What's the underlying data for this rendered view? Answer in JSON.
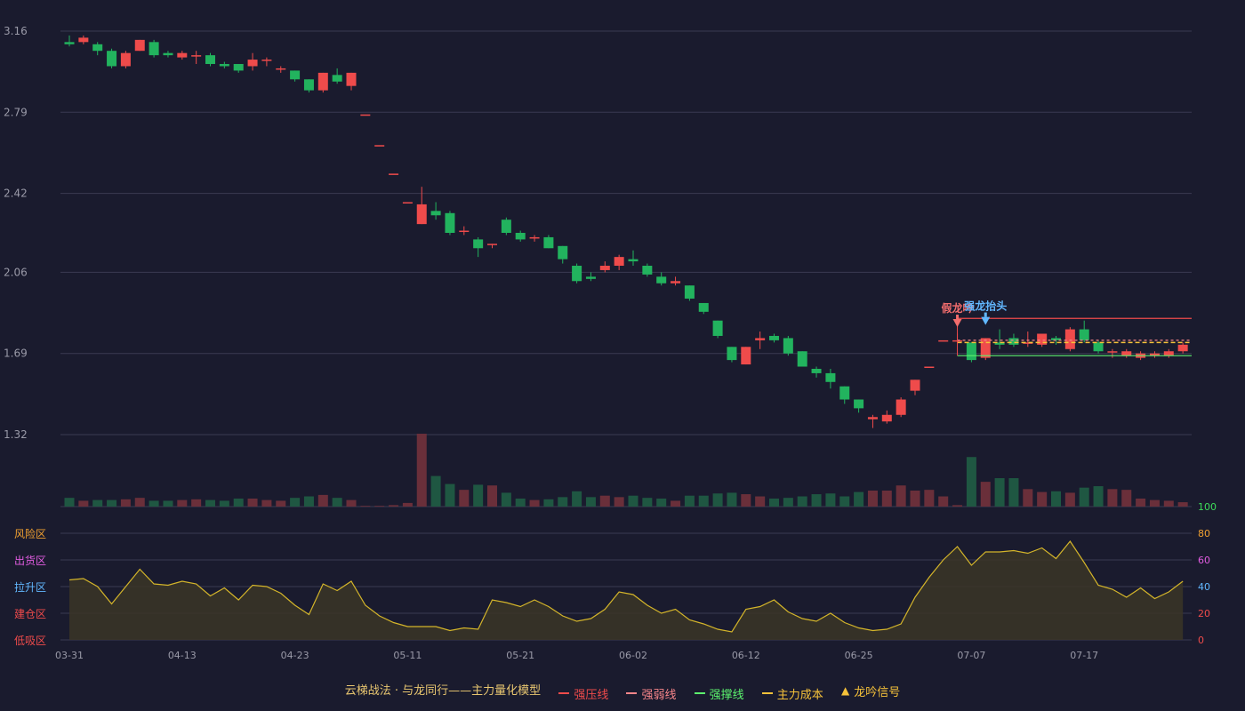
{
  "legend": {
    "title": "云梯战法 · 与龙同行——主力量化模型",
    "items": [
      {
        "label": "强压线",
        "color": "#ef4b4b",
        "style": "solid"
      },
      {
        "label": "强弱线",
        "color": "#f7868a",
        "style": "dashed"
      },
      {
        "label": "强撑线",
        "color": "#5cf26e",
        "style": "solid"
      },
      {
        "label": "主力成本",
        "color": "#f6c23a",
        "style": "dashed"
      },
      {
        "label": "龙吟信号",
        "color": "#f6c23a",
        "style": "triangle"
      }
    ]
  },
  "colors": {
    "background": "#1a1b2e",
    "up": "#ef4b4b",
    "down": "#22b35e",
    "grid": "#3a3b52",
    "axis_text": "#9a9aa8",
    "osc_line": "#d4b52a",
    "osc_fill": "#3b3526",
    "pressure": "#ef4b4b",
    "weak": "#f7868a",
    "support": "#5cf26e",
    "cost": "#f6c23a",
    "fake_dragon": "#f26d6d",
    "dragon_head": "#62b8ff"
  },
  "chart_data": [
    {
      "type": "candlestick",
      "y_ticks": [
        1.32,
        1.69,
        2.06,
        2.42,
        2.79,
        3.16
      ],
      "ylim": [
        1.32,
        3.16
      ],
      "x_tick_labels": [
        {
          "index": 0,
          "label": "03-31"
        },
        {
          "index": 8,
          "label": "04-13"
        },
        {
          "index": 16,
          "label": "04-23"
        },
        {
          "index": 24,
          "label": "05-11"
        },
        {
          "index": 32,
          "label": "05-21"
        },
        {
          "index": 40,
          "label": "06-02"
        },
        {
          "index": 48,
          "label": "06-12"
        },
        {
          "index": 56,
          "label": "06-25"
        },
        {
          "index": 64,
          "label": "07-07"
        },
        {
          "index": 72,
          "label": "07-17"
        }
      ],
      "candles": [
        [
          3.11,
          3.1,
          3.14,
          3.09
        ],
        [
          3.11,
          3.13,
          3.14,
          3.1
        ],
        [
          3.1,
          3.07,
          3.11,
          3.05
        ],
        [
          3.07,
          3.0,
          3.08,
          2.99
        ],
        [
          3.0,
          3.06,
          3.07,
          2.99
        ],
        [
          3.07,
          3.12,
          3.12,
          3.07
        ],
        [
          3.11,
          3.05,
          3.12,
          3.04
        ],
        [
          3.06,
          3.05,
          3.07,
          3.04
        ],
        [
          3.04,
          3.06,
          3.07,
          3.03
        ],
        [
          3.05,
          3.05,
          3.07,
          3.01
        ],
        [
          3.05,
          3.01,
          3.06,
          3.0
        ],
        [
          3.01,
          3.0,
          3.02,
          2.99
        ],
        [
          3.01,
          2.98,
          3.01,
          2.97
        ],
        [
          3.0,
          3.03,
          3.06,
          2.98
        ],
        [
          3.03,
          3.03,
          3.04,
          3.0
        ],
        [
          2.99,
          2.99,
          3.0,
          2.97
        ],
        [
          2.98,
          2.94,
          2.98,
          2.93
        ],
        [
          2.94,
          2.89,
          2.94,
          2.88
        ],
        [
          2.89,
          2.97,
          2.97,
          2.88
        ],
        [
          2.96,
          2.93,
          2.99,
          2.92
        ],
        [
          2.91,
          2.97,
          2.97,
          2.89
        ],
        [
          2.78,
          2.78,
          2.78,
          2.78
        ],
        [
          2.64,
          2.64,
          2.64,
          2.64
        ],
        [
          2.51,
          2.51,
          2.51,
          2.51
        ],
        [
          2.38,
          2.38,
          2.38,
          2.38
        ],
        [
          2.28,
          2.37,
          2.45,
          2.28
        ],
        [
          2.34,
          2.32,
          2.38,
          2.3
        ],
        [
          2.33,
          2.24,
          2.34,
          2.23
        ],
        [
          2.25,
          2.25,
          2.27,
          2.23
        ],
        [
          2.21,
          2.17,
          2.22,
          2.13
        ],
        [
          2.19,
          2.19,
          2.19,
          2.17
        ],
        [
          2.3,
          2.24,
          2.31,
          2.23
        ],
        [
          2.24,
          2.21,
          2.25,
          2.2
        ],
        [
          2.22,
          2.22,
          2.23,
          2.2
        ],
        [
          2.22,
          2.17,
          2.23,
          2.17
        ],
        [
          2.18,
          2.12,
          2.18,
          2.1
        ],
        [
          2.09,
          2.02,
          2.1,
          2.01
        ],
        [
          2.04,
          2.03,
          2.06,
          2.02
        ],
        [
          2.07,
          2.09,
          2.11,
          2.06
        ],
        [
          2.09,
          2.13,
          2.14,
          2.07
        ],
        [
          2.12,
          2.11,
          2.16,
          2.09
        ],
        [
          2.09,
          2.05,
          2.1,
          2.04
        ],
        [
          2.04,
          2.01,
          2.06,
          2.0
        ],
        [
          2.01,
          2.02,
          2.04,
          2.0
        ],
        [
          2.0,
          1.94,
          2.0,
          1.93
        ],
        [
          1.92,
          1.88,
          1.92,
          1.87
        ],
        [
          1.84,
          1.77,
          1.84,
          1.76
        ],
        [
          1.72,
          1.66,
          1.72,
          1.65
        ],
        [
          1.64,
          1.72,
          1.72,
          1.64
        ],
        [
          1.75,
          1.76,
          1.79,
          1.71
        ],
        [
          1.77,
          1.75,
          1.78,
          1.74
        ],
        [
          1.76,
          1.69,
          1.77,
          1.68
        ],
        [
          1.7,
          1.63,
          1.7,
          1.63
        ],
        [
          1.62,
          1.6,
          1.63,
          1.58
        ],
        [
          1.6,
          1.56,
          1.62,
          1.53
        ],
        [
          1.54,
          1.48,
          1.54,
          1.46
        ],
        [
          1.48,
          1.44,
          1.48,
          1.42
        ],
        [
          1.39,
          1.4,
          1.41,
          1.35
        ],
        [
          1.38,
          1.41,
          1.43,
          1.37
        ],
        [
          1.41,
          1.48,
          1.49,
          1.4
        ],
        [
          1.52,
          1.57,
          1.57,
          1.5
        ],
        [
          1.63,
          1.63,
          1.63,
          1.63
        ],
        [
          1.75,
          1.75,
          1.75,
          1.75
        ],
        [
          1.75,
          1.75,
          1.78,
          1.74
        ],
        [
          1.74,
          1.66,
          1.74,
          1.65
        ],
        [
          1.67,
          1.76,
          1.76,
          1.66
        ],
        [
          1.74,
          1.73,
          1.8,
          1.71
        ],
        [
          1.76,
          1.73,
          1.78,
          1.72
        ],
        [
          1.74,
          1.74,
          1.79,
          1.72
        ],
        [
          1.73,
          1.78,
          1.78,
          1.72
        ],
        [
          1.76,
          1.75,
          1.77,
          1.73
        ],
        [
          1.71,
          1.8,
          1.81,
          1.7
        ],
        [
          1.8,
          1.75,
          1.84,
          1.74
        ],
        [
          1.74,
          1.7,
          1.75,
          1.69
        ],
        [
          1.7,
          1.7,
          1.71,
          1.67
        ],
        [
          1.68,
          1.7,
          1.71,
          1.67
        ],
        [
          1.67,
          1.69,
          1.7,
          1.66
        ],
        [
          1.68,
          1.69,
          1.7,
          1.67
        ],
        [
          1.68,
          1.7,
          1.71,
          1.67
        ],
        [
          1.7,
          1.73,
          1.74,
          1.69
        ]
      ],
      "volume": [
        12,
        8,
        9,
        9,
        10,
        12,
        8,
        8,
        9,
        10,
        9,
        8,
        11,
        11,
        9,
        8,
        12,
        14,
        16,
        12,
        9,
        1,
        1,
        2,
        5,
        100,
        42,
        31,
        23,
        30,
        29,
        19,
        11,
        9,
        10,
        13,
        21,
        13,
        15,
        13,
        15,
        12,
        11,
        8,
        15,
        15,
        18,
        19,
        17,
        14,
        11,
        12,
        14,
        17,
        18,
        14,
        20,
        22,
        22,
        29,
        22,
        23,
        14,
        2,
        68,
        34,
        39,
        39,
        24,
        20,
        21,
        19,
        26,
        28,
        24,
        23,
        11,
        9,
        8,
        6,
        9
      ],
      "volume_scale_label": "100",
      "pressure_line": {
        "from_index": 63,
        "value": 1.85
      },
      "weak_line": {
        "from_index": 63,
        "value": 1.75
      },
      "cost_line": {
        "from_index": 63,
        "value": 1.74
      },
      "support_line": {
        "from_index": 63,
        "value": 1.68
      },
      "annotations": [
        {
          "index": 63,
          "text": "假龙吟",
          "kind": "fake_dragon",
          "price": 1.79
        },
        {
          "index": 65,
          "text": "强龙抬头",
          "kind": "dragon_head",
          "price": 1.8
        }
      ]
    },
    {
      "type": "area",
      "ylim": [
        0,
        80
      ],
      "y_ticks": [
        0,
        20,
        40,
        60,
        80
      ],
      "y_tick_colors": [
        "#ef4b4b",
        "#ef4b4b",
        "#62b8ff",
        "#e05ce0",
        "#f0a030"
      ],
      "zone_labels": [
        {
          "label": "低吸区",
          "color": "#ef4b4b"
        },
        {
          "label": "建仓区",
          "color": "#ef4b4b"
        },
        {
          "label": "拉升区",
          "color": "#62b8ff"
        },
        {
          "label": "出货区",
          "color": "#e05ce0"
        },
        {
          "label": "风险区",
          "color": "#f0a030"
        }
      ],
      "values": [
        45,
        46,
        40,
        27,
        40,
        53,
        42,
        41,
        44,
        42,
        33,
        39,
        30,
        41,
        40,
        35,
        26,
        19,
        42,
        37,
        44,
        26,
        18,
        13,
        10,
        10,
        10,
        7,
        9,
        8,
        30,
        28,
        25,
        30,
        25,
        18,
        14,
        16,
        23,
        36,
        34,
        26,
        20,
        23,
        15,
        12,
        8,
        6,
        23,
        25,
        30,
        21,
        16,
        14,
        20,
        13,
        9,
        7,
        8,
        12,
        32,
        47,
        60,
        70,
        56,
        66,
        66,
        67,
        65,
        69,
        61,
        74,
        58,
        41,
        38,
        32,
        39,
        31,
        36,
        44
      ]
    }
  ]
}
